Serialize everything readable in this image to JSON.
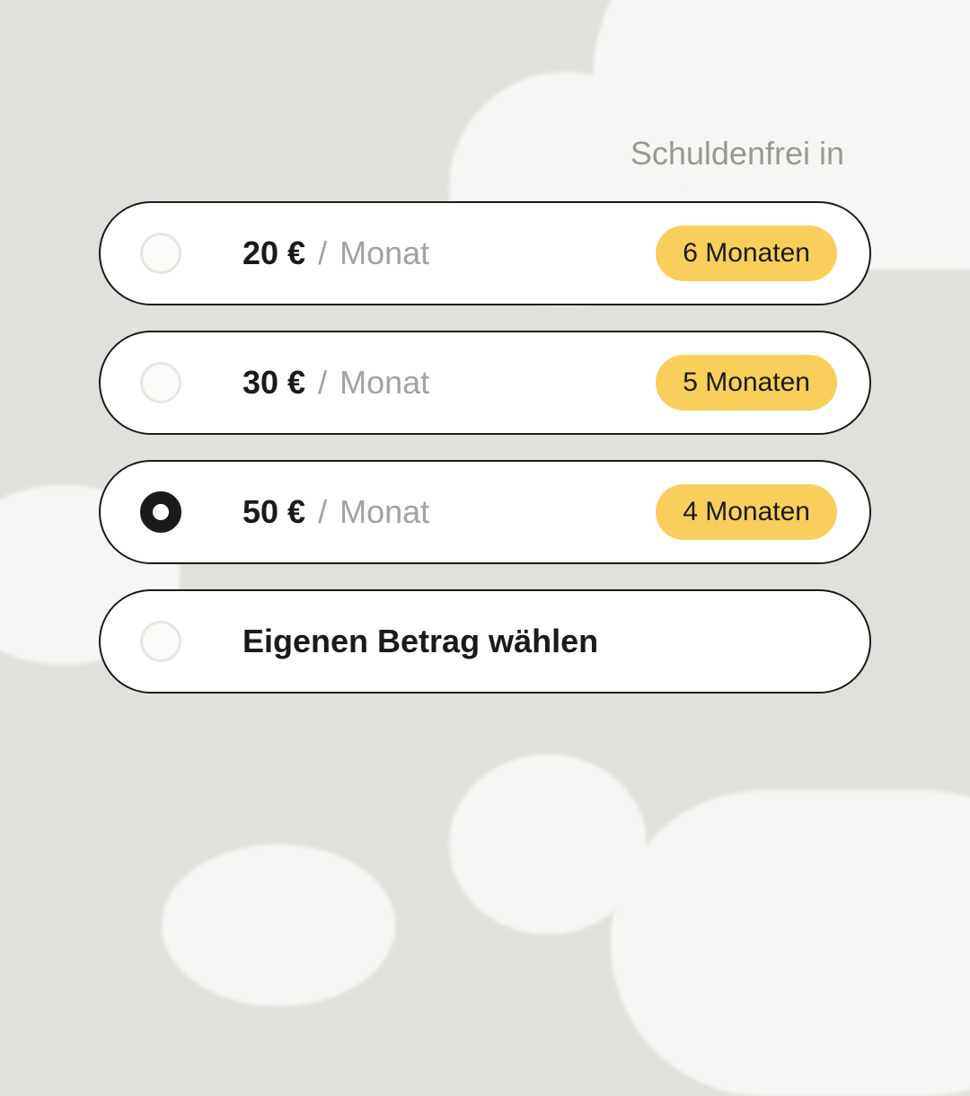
{
  "header": {
    "label": "Schuldenfrei in"
  },
  "options": [
    {
      "amount": "20 €",
      "slash": "/",
      "period": "Monat",
      "badge": "6 Monaten",
      "selected": false
    },
    {
      "amount": "30 €",
      "slash": "/",
      "period": "Monat",
      "badge": "5 Monaten",
      "selected": false
    },
    {
      "amount": "50 €",
      "slash": "/",
      "period": "Monat",
      "badge": "4 Monaten",
      "selected": true
    }
  ],
  "custom_option": {
    "label": "Eigenen Betrag wählen",
    "selected": false
  },
  "colors": {
    "accent_badge": "#f8cf5a",
    "card_border": "#1a1a1a"
  }
}
